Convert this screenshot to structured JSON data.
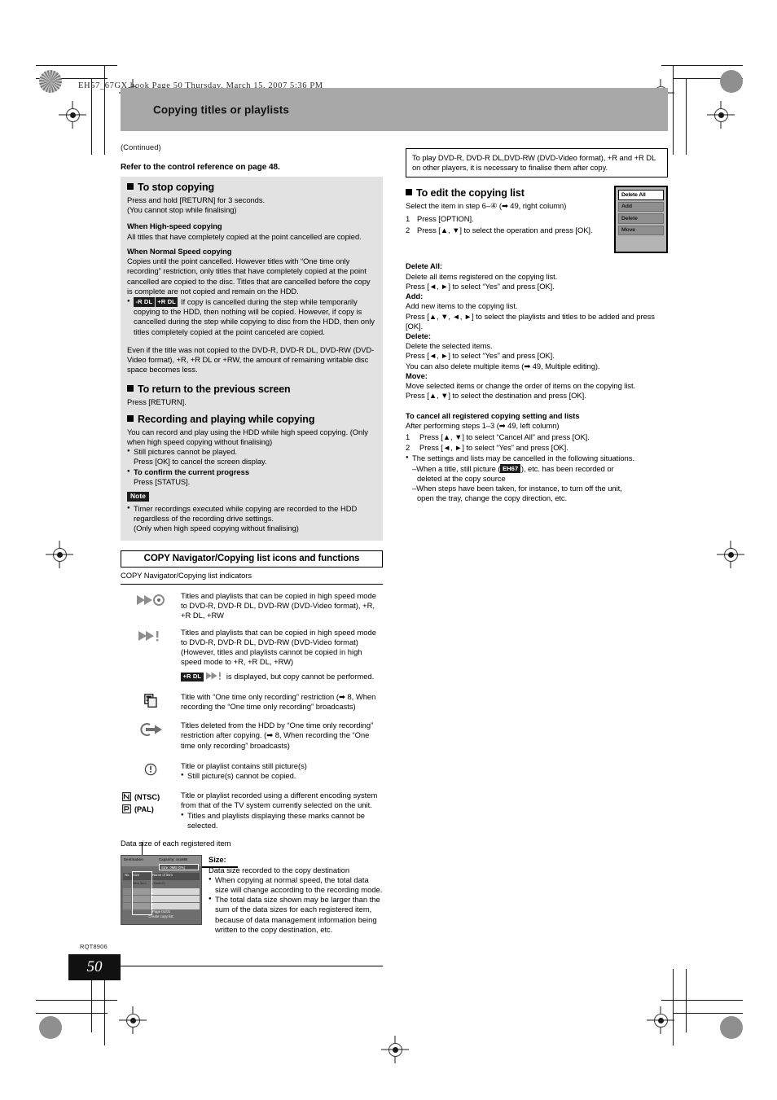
{
  "file_header": "EH57_67GX.book  Page 50  Thursday, March 15, 2007  5:36 PM",
  "title_band": {
    "title": "Copying titles or playlists"
  },
  "continued_note": "(Continued)",
  "page_footer": {
    "doc_code": "RQT8906",
    "page_number": "50"
  },
  "left_column": {
    "reference_line": "Refer to the control reference on page 48.",
    "stop_copying": {
      "heading": "To stop copying",
      "line1": "Press and hold [RETURN] for 3 seconds.",
      "line2": "(You cannot stop while finalising)",
      "high_speed_heading": "When High-speed copying",
      "high_speed_body": "All titles that have completely copied at the point cancelled are copied.",
      "normal_speed_heading": "When Normal Speed copying",
      "normal_speed_body": "Copies until the point cancelled. However titles with “One time only recording” restriction, only titles that have completely copied at the point cancelled are copied to the disc. Titles that are cancelled before the copy is complete are not copied and remain on the HDD.",
      "dl_badge_1": "-R DL",
      "dl_badge_2": "+R DL",
      "dl_bullet": "If copy is cancelled during the step while temporarily copying to the HDD, then nothing will be copied. However, if copy is cancelled during the step while copying to disc from the HDD, then only titles completely copied at the point canceled are copied.",
      "closing_paragraph": "Even if the title was not copied to the DVD-R, DVD-R DL, DVD-RW (DVD-Video format), +R, +R DL or +RW, the amount of remaining writable disc space becomes less."
    },
    "return_screen": {
      "heading": "To return to the previous screen",
      "body": "Press [RETURN]."
    },
    "recording_playing": {
      "heading": "Recording and playing while copying",
      "body": "You can record and play using the HDD while high speed copying. (Only when high speed copying without finalising)",
      "bullet1": "Still pictures cannot be played.",
      "bullet1_sub": "Press [OK] to cancel the screen display.",
      "bullet2": "To confirm the current progress",
      "bullet2_sub": "Press [STATUS].",
      "note_badge": "Note",
      "note_bullet": "Timer recordings executed while copying are recorded to the HDD regardless of the recording drive settings.",
      "note_sub": "(Only when high speed copying without finalising)"
    },
    "copy_navigator": {
      "banner": "COPY Navigator/Copying list icons and functions",
      "subheading": "COPY Navigator/Copying list indicators",
      "indicators": [
        {
          "icon": "fast-forward-disc-icon",
          "text": "Titles and playlists that can be copied in high speed mode to DVD-R, DVD-R DL, DVD-RW (DVD-Video format), +R, +R DL, +RW"
        },
        {
          "icon": "fast-forward-exclaim-icon",
          "text_lines": [
            "Titles and playlists that can be copied in high speed mode to DVD-R, DVD-R DL, DVD-RW (DVD-Video format)",
            "(However, titles and playlists cannot be copied in high speed mode to +R, +R DL, +RW)"
          ],
          "sub_badge": "+R DL",
          "sub_text": "is displayed, but copy cannot be performed."
        },
        {
          "icon": "one-time-only-recording-icon",
          "text": "Title with “One time only recording” restriction (➡ 8, When recording the “One time only recording” broadcasts)"
        },
        {
          "icon": "deleted-after-copy-arrow-icon",
          "text": "Titles deleted from the HDD by “One time only recording” restriction after copying. (➡ 8, When recording the “One time only recording” broadcasts)"
        },
        {
          "icon": "still-picture-warning-icon",
          "text": "Title or playlist contains still picture(s)",
          "bullet": "Still picture(s) cannot be copied."
        },
        {
          "icon": "ntsc-pal-icon",
          "label_ntsc": "(NTSC)",
          "label_pal": "(PAL)",
          "text": "Title or playlist recorded using a different encoding system from that of the TV system currently selected on the unit.",
          "bullet": "Titles and playlists displaying these marks cannot be selected."
        }
      ]
    },
    "data_size": {
      "caption": "Data size of each registered item",
      "screen_mock": {
        "destination_label": "Destination",
        "capacity_label": "Capacity: xxxMB",
        "size_label": "Size:        0MB (0%)",
        "col_no": "No.",
        "col_size": "Size",
        "col_name": "Name of item",
        "row_new": "New item",
        "row_total": "(Total=0)",
        "page_label": "Page 01/01",
        "footer": "Create copy list."
      },
      "size_heading": "Size:",
      "size_body": "Data size recorded to the copy destination",
      "size_bullet1": "When copying at normal speed, the total data size will change according to the recording mode.",
      "size_bullet2": "The total data size shown may be larger than the sum of the data sizes for each registered item, because of data management information being written to the copy destination, etc."
    }
  },
  "right_column": {
    "finalise_box": "To play DVD-R, DVD-R DL,DVD-RW (DVD-Video format), +R and +R DL on other players, it is necessary to finalise them after copy.",
    "edit_list": {
      "heading": "To edit the copying list",
      "intro": "Select the item in step 6–④ (➡ 49, right column)",
      "step1_num": "1",
      "step1": "Press [OPTION].",
      "step2_num": "2",
      "step2": "Press [▲, ▼] to select the operation and press [OK]."
    },
    "option_menu": {
      "items": [
        "Delete All",
        "Add",
        "Delete",
        "Move"
      ],
      "selected": "Delete All"
    },
    "operations": [
      {
        "title": "Delete All:",
        "lines": [
          "Delete all items registered on the copying list.",
          "Press [◄, ►] to select “Yes” and press [OK]."
        ]
      },
      {
        "title": "Add:",
        "lines": [
          "Add new items to the copying list.",
          "Press [▲, ▼, ◄, ►] to select the playlists and titles to be added and press [OK]."
        ]
      },
      {
        "title": "Delete:",
        "lines": [
          "Delete the selected items.",
          "Press [◄, ►] to select “Yes” and press [OK].",
          "You can also delete multiple items (➡ 49, Multiple editing)."
        ]
      },
      {
        "title": "Move:",
        "lines": [
          "Move selected items or change the order of items on the copying list.",
          "Press [▲, ▼] to select the destination and press [OK]."
        ]
      }
    ],
    "cancel_all": {
      "heading": "To cancel all registered copying setting and lists",
      "intro": "After performing steps 1–3 (➡ 49, left column)",
      "step1_num": "1",
      "step1": "Press [▲, ▼] to select “Cancel All” and press [OK].",
      "step2_num": "2",
      "step2": "Press [◄, ►] to select “Yes” and press [OK].",
      "bullet": "The settings and lists may be cancelled in the following situations.",
      "dash1_pre": "–When a title, still picture (",
      "dash1_badge": "EH67",
      "dash1_post": "), etc. has been recorded or",
      "dash1_cont": "deleted at the copy source",
      "dash2": "–When steps have been taken, for instance, to turn off the unit,",
      "dash2_cont": "open the tray, change the copy direction, etc."
    }
  }
}
